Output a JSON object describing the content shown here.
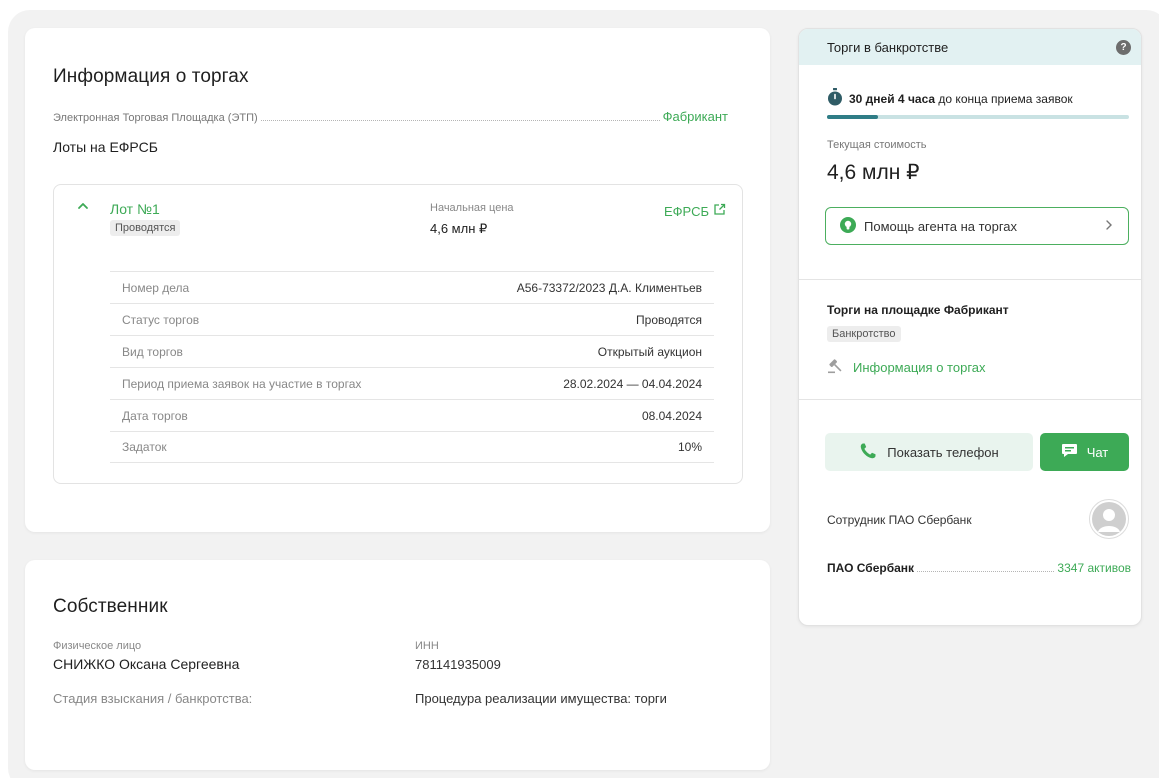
{
  "info": {
    "title": "Информация о торгах",
    "etp_label": "Электронная Торговая Площадка (ЭТП)",
    "etp_value": "Фабрикант",
    "lots_label": "Лоты на ЕФРСБ",
    "lot": {
      "title": "Лот №1",
      "status_badge": "Проводятся",
      "price_label": "Начальная цена",
      "price_value": "4,6 млн ₽",
      "efrsb_link": "ЕФРСБ",
      "details": [
        {
          "label": "Номер дела",
          "value": "А56-73372/2023 Д.А. Климентьев"
        },
        {
          "label": "Статус торгов",
          "value": "Проводятся"
        },
        {
          "label": "Вид торгов",
          "value": "Открытый аукцион"
        },
        {
          "label": "Период приема заявок на участие в торгах",
          "value": "28.02.2024 — 04.04.2024"
        },
        {
          "label": "Дата торгов",
          "value": "08.04.2024"
        },
        {
          "label": "Задаток",
          "value": "10%"
        }
      ]
    }
  },
  "owner": {
    "title": "Собственник",
    "type_label": "Физическое лицо",
    "name": "СНИЖКО Оксана Сергеевна",
    "inn_label": "ИНН",
    "inn_value": "781141935009",
    "stage_label": "Стадия взыскания / банкротства:",
    "stage_value": "Процедура реализации имущества: торги"
  },
  "side": {
    "header_title": "Торги в банкротстве",
    "help_icon": "?",
    "timer_bold": "30 дней 4 часа",
    "timer_rest": "до конца приема заявок",
    "timer_progress": 0.17,
    "current_label": "Текущая стоимость",
    "current_value": "4,6 млн ₽",
    "agent_button": "Помощь агента на торгах",
    "platform_title": "Торги на площадке Фабрикант",
    "platform_badge": "Банкротство",
    "info_link": "Информация о торгах",
    "phone_button": "Показать телефон",
    "chat_button": "Чат",
    "employee": "Сотрудник ПАО Сбербанк",
    "bank_name": "ПАО Сбербанк",
    "bank_assets": "3347 активов"
  },
  "colors": {
    "accent_green": "#3daa56",
    "header_teal": "#e2f1f2",
    "progress_fill": "#2f7d86"
  }
}
